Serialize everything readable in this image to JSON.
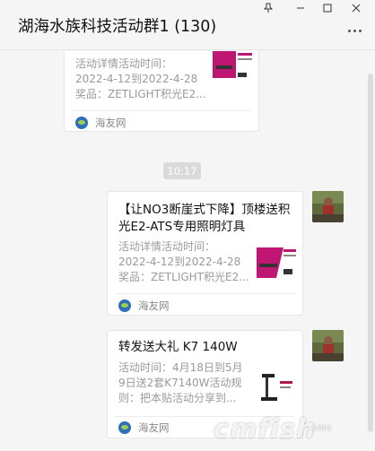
{
  "window": {
    "title": "湖海水族科技活动群1 (130)"
  },
  "chat": {
    "timestamp": "10:17",
    "cards": [
      {
        "title_lines": [],
        "desc_lines": [
          "活动详情活动时间：",
          "2022-4-12到2022-4-28",
          "奖品：ZETLIGHT积光E2..."
        ],
        "source": "海友网"
      },
      {
        "title_lines": [
          "【让NO3断崖式下降】顶楼送积",
          "光E2-ATS专用照明灯具"
        ],
        "desc_lines": [
          "活动详情活动时间：",
          "2022-4-12到2022-4-28",
          "奖品：ZETLIGHT积光E2..."
        ],
        "source": "海友网"
      },
      {
        "title_lines": [
          "转发送大礼 K7 140W"
        ],
        "desc_lines": [
          "活动时间：4月18日到5月",
          "9日送2套K7140W活动规",
          "则：把本贴活动分享到..."
        ],
        "source": "海友网"
      }
    ]
  },
  "watermark": {
    "main": "cmfish",
    "sub": ".com"
  },
  "colors": {
    "accent_pink": "#d0187a",
    "source_blue": "#2d6fb8"
  }
}
